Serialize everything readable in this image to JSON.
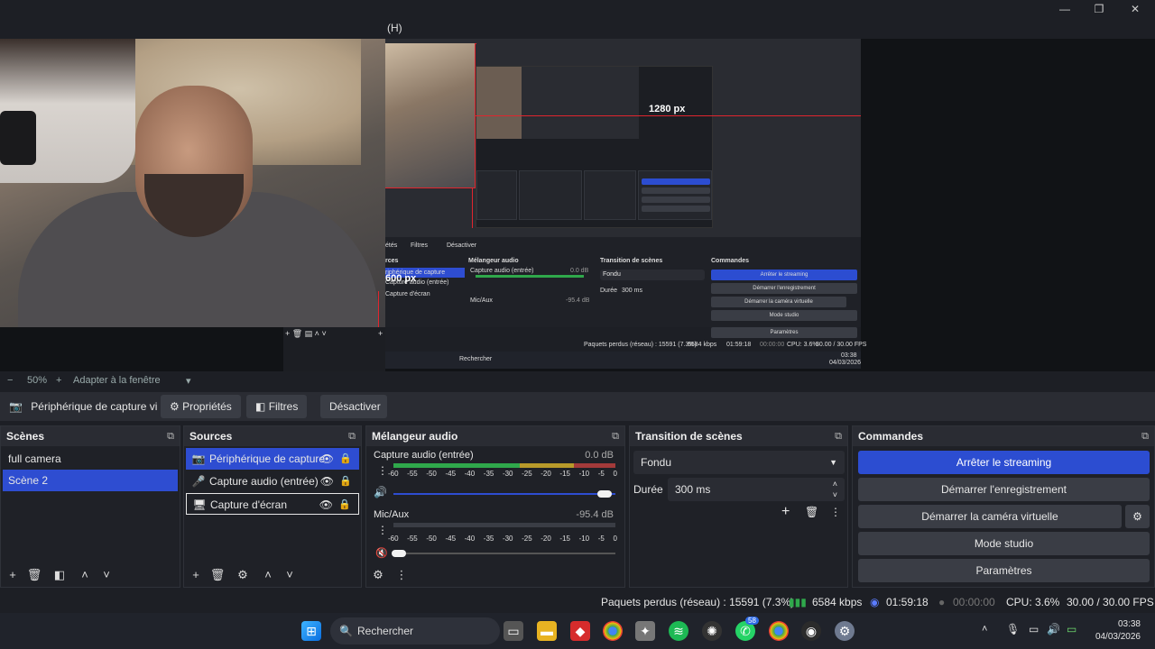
{
  "window": {
    "menu_fragment": "(H)"
  },
  "preview": {
    "width_label": "1280 px",
    "height_label": "600 px",
    "mini_labels": {
      "mixer": "Mélangeur audio",
      "transition": "Transition de scènes",
      "commands": "Commandes",
      "sources": "rces",
      "stop_streaming": "Arrêter le streaming",
      "start_recording": "Démarrer l'enregistrement",
      "virtual_cam": "Démarrer la caméra virtuelle",
      "studio": "Mode studio",
      "settings": "Paramètres",
      "fade": "Fondu",
      "duration_label": "Durée",
      "duration": "300 ms",
      "src1": "riphérique de capture",
      "src2": "Capture audio (entrée)",
      "src3": "Capture d'écran",
      "mix1": "Capture audio (entrée)",
      "mix2": "Mic/Aux",
      "mix1_db": "0.0 dB",
      "mix2_db": "-95.4 dB",
      "filters": "Filtres",
      "props": "étés",
      "deactivate": "Désactiver",
      "status": "Paquets perdus (réseau) : 15591 (7.3%)",
      "kbps": "6584 kbps",
      "time": "01:59:18",
      "rec_time": "00:00:00",
      "cpu": "CPU: 3.6%",
      "fps": "30.00 / 30.00 FPS",
      "search": "Rechercher",
      "clock_time": "03:38",
      "clock_date": "04/03/2026"
    }
  },
  "zoom": {
    "minus": "−",
    "value": "50%",
    "plus": "+",
    "fit": "Adapter à la fenêtre",
    "chevron": "▾"
  },
  "source_toolbar": {
    "source_name": "Périphérique de capture vi",
    "properties": "Propriétés",
    "filters": "Filtres",
    "deactivate": "Désactiver"
  },
  "scenes": {
    "title": "Scènes",
    "items": [
      "full camera",
      "Scène 2"
    ],
    "selected": 1
  },
  "sources": {
    "title": "Sources",
    "items": [
      {
        "label": "Périphérique de capture",
        "icon": "camera-icon"
      },
      {
        "label": "Capture audio (entrée)",
        "icon": "microphone-icon"
      },
      {
        "label": "Capture d'écran",
        "icon": "monitor-icon"
      }
    ]
  },
  "mixer": {
    "title": "Mélangeur audio",
    "channels": [
      {
        "name": "Capture audio (entrée)",
        "db": "0.0 dB",
        "level": 0.82,
        "volume": 1.0
      },
      {
        "name": "Mic/Aux",
        "db": "-95.4 dB",
        "level": 0.0,
        "volume": 0.04
      }
    ],
    "ticks": [
      "-60",
      "-55",
      "-50",
      "-45",
      "-40",
      "-35",
      "-30",
      "-25",
      "-20",
      "-15",
      "-10",
      "-5",
      "0"
    ]
  },
  "transition": {
    "title": "Transition de scènes",
    "type": "Fondu",
    "duration_label": "Durée",
    "duration": "300 ms"
  },
  "commands": {
    "title": "Commandes",
    "stop_streaming": "Arrêter le streaming",
    "start_recording": "Démarrer l'enregistrement",
    "virtual_cam": "Démarrer la caméra virtuelle",
    "studio": "Mode studio",
    "settings": "Paramètres"
  },
  "status": {
    "dropped": "Paquets perdus (réseau) : 15591 (7.3%)",
    "bitrate": "6584 kbps",
    "stream_time": "01:59:18",
    "rec_time": "00:00:00",
    "cpu": "CPU: 3.6%",
    "fps": "30.00 / 30.00 FPS"
  },
  "taskbar": {
    "search": "Rechercher",
    "time": "03:38",
    "date": "04/03/2026",
    "badge": "58"
  },
  "colors": {
    "accent": "#2e4dd1",
    "bg": "#1d1f25",
    "panel": "#2a2c33",
    "meter_green": "#2fa84b",
    "meter_yellow": "#b89a2a",
    "meter_red": "#a33a3a",
    "guide_red": "#e0252e"
  }
}
